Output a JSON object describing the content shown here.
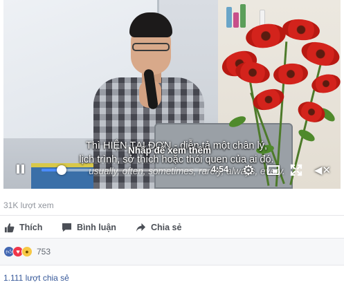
{
  "video": {
    "subtitle_line1": "Thì HIỆN TẠI ĐƠN - diễn tả một chân lý,",
    "subtitle_line2": "lịch trình, sở thích hoặc thói quen của ai đó.",
    "hint_overlay": "Nhấp để xem thêm",
    "subtitle_line3": "usually, often, sometimes, rarely, always, every.",
    "time_remaining": "4:54",
    "progress_fraction": 0.12,
    "accent_color": "#4a8cff"
  },
  "stats": {
    "views": "31K lượt xem",
    "reaction_count": "753",
    "shares": "1.111 lượt chia sẻ"
  },
  "actions": {
    "like_label": "Thích",
    "comment_label": "Bình luận",
    "share_label": "Chia sẻ"
  },
  "icons": {
    "pause": "pause-icon",
    "settings": "gear-icon",
    "pip": "picture-in-picture-icon",
    "fullscreen": "expand-icon",
    "mute": "volume-muted-icon",
    "like": "thumbs-up-icon",
    "comment": "speech-bubble-icon",
    "share": "share-arrow-icon",
    "reactions": [
      "like-reaction-icon",
      "love-reaction-icon",
      "wow-reaction-icon"
    ]
  }
}
